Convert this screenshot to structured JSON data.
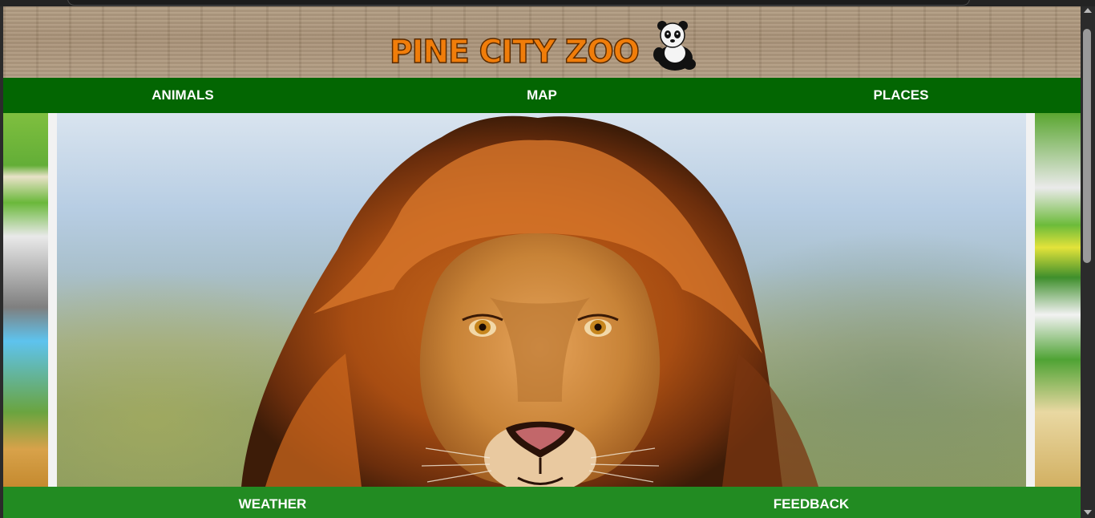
{
  "site": {
    "logo_text": "PINE CITY ZOO",
    "logo_icon": "panda-icon"
  },
  "nav_top": {
    "items": [
      {
        "label": "ANIMALS"
      },
      {
        "label": "MAP"
      },
      {
        "label": "PLACES"
      }
    ]
  },
  "nav_bottom": {
    "items": [
      {
        "label": "WEATHER"
      },
      {
        "label": "FEEDBACK"
      }
    ]
  },
  "hero": {
    "subject": "lion"
  },
  "colors": {
    "nav_top_bg": "#036602",
    "nav_bottom_bg": "#228b22",
    "logo_orange": "#f07d0a",
    "nav_text": "#ffffff"
  }
}
